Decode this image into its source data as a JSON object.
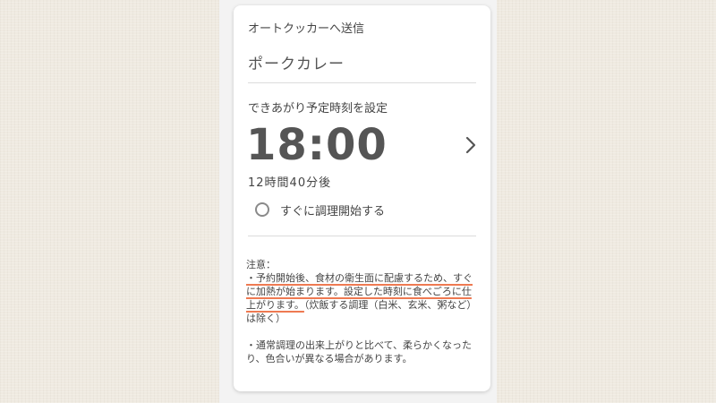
{
  "header": {
    "send_label": "オートクッカーへ送信",
    "recipe_name": "ポークカレー"
  },
  "schedule": {
    "label": "できあがり予定時刻を設定",
    "time": "18:00",
    "relative": "12時間40分後",
    "chevron_icon": "chevron-right-icon"
  },
  "option": {
    "start_now_label": "すぐに調理開始する",
    "selected": false
  },
  "notes": {
    "title": "注意：",
    "note1_underlined": "・予約開始後、食材の衛生面に配慮するため、すぐに加熱が始まります。設定した時刻に食べごろに仕上がります。",
    "note1_rest": "（炊飯する調理（白米、玄米、粥など）は除く）",
    "note2": "・通常調理の出来上がりと比べて、柔らかくなったり、色合いが異なる場合があります。",
    "highlight_color": "#ee7a52"
  }
}
